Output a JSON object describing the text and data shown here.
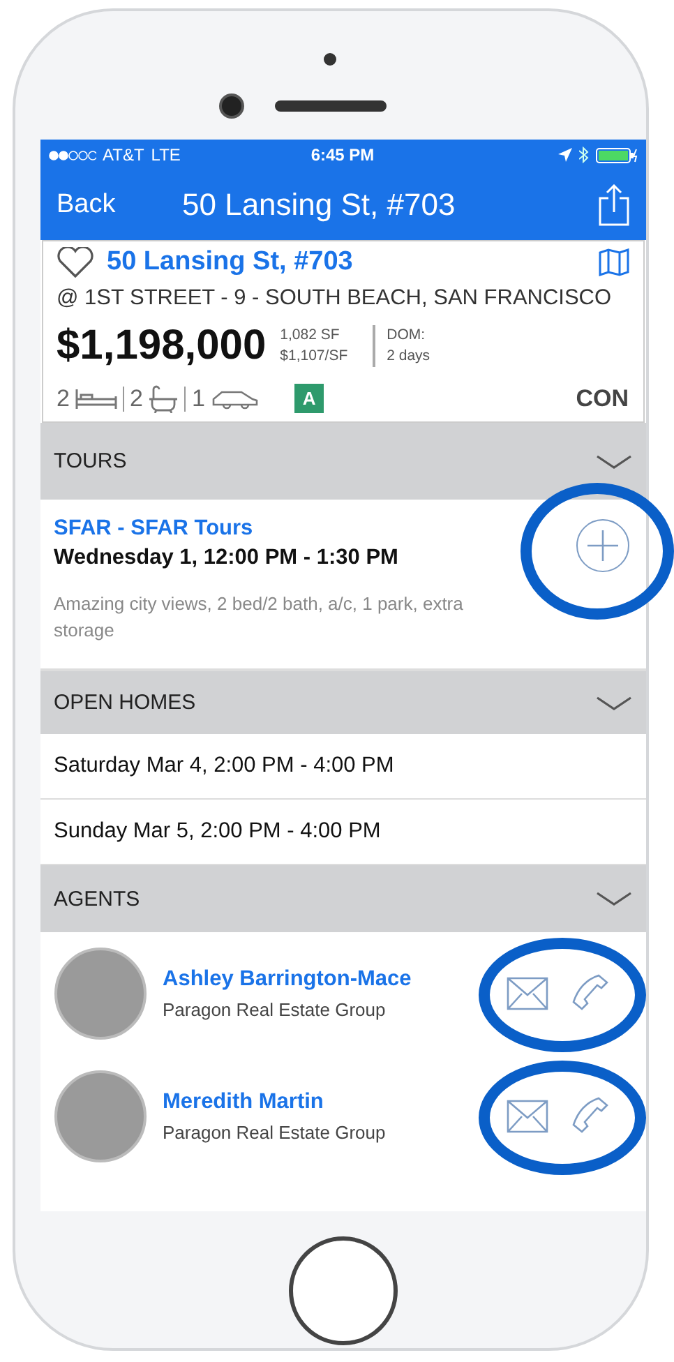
{
  "status_bar": {
    "carrier": "AT&T",
    "network": "LTE",
    "time": "6:45 PM"
  },
  "nav": {
    "back": "Back",
    "title": "50 Lansing St, #703"
  },
  "listing": {
    "title": "50 Lansing St, #703",
    "address": "@ 1ST STREET - 9 - SOUTH BEACH, SAN FRANCISCO",
    "price": "$1,198,000",
    "sqft": "1,082 SF",
    "price_per_sf": "$1,107/SF",
    "dom_label": "DOM:",
    "dom_value": "2 days",
    "beds": "2",
    "baths": "2",
    "parking": "1",
    "badge": "A",
    "type": "CON"
  },
  "tours": {
    "title": "TOURS",
    "items": [
      {
        "org": "SFAR - SFAR Tours",
        "when": "Wednesday 1, 12:00 PM - 1:30 PM",
        "note": "Amazing city views, 2 bed/2 bath, a/c, 1 park, extra storage",
        "highlighted": true
      }
    ]
  },
  "open_homes": {
    "title": "OPEN HOMES",
    "items": [
      "Saturday Mar 4, 2:00 PM - 4:00 PM",
      "Sunday Mar 5, 2:00 PM - 4:00 PM"
    ]
  },
  "agents": {
    "title": "AGENTS",
    "items": [
      {
        "name": "Ashley Barrington-Mace",
        "company": "Paragon Real Estate Group",
        "highlighted": true
      },
      {
        "name": "Meredith Martin",
        "company": "Paragon Real Estate Group",
        "highlighted": true
      }
    ]
  }
}
